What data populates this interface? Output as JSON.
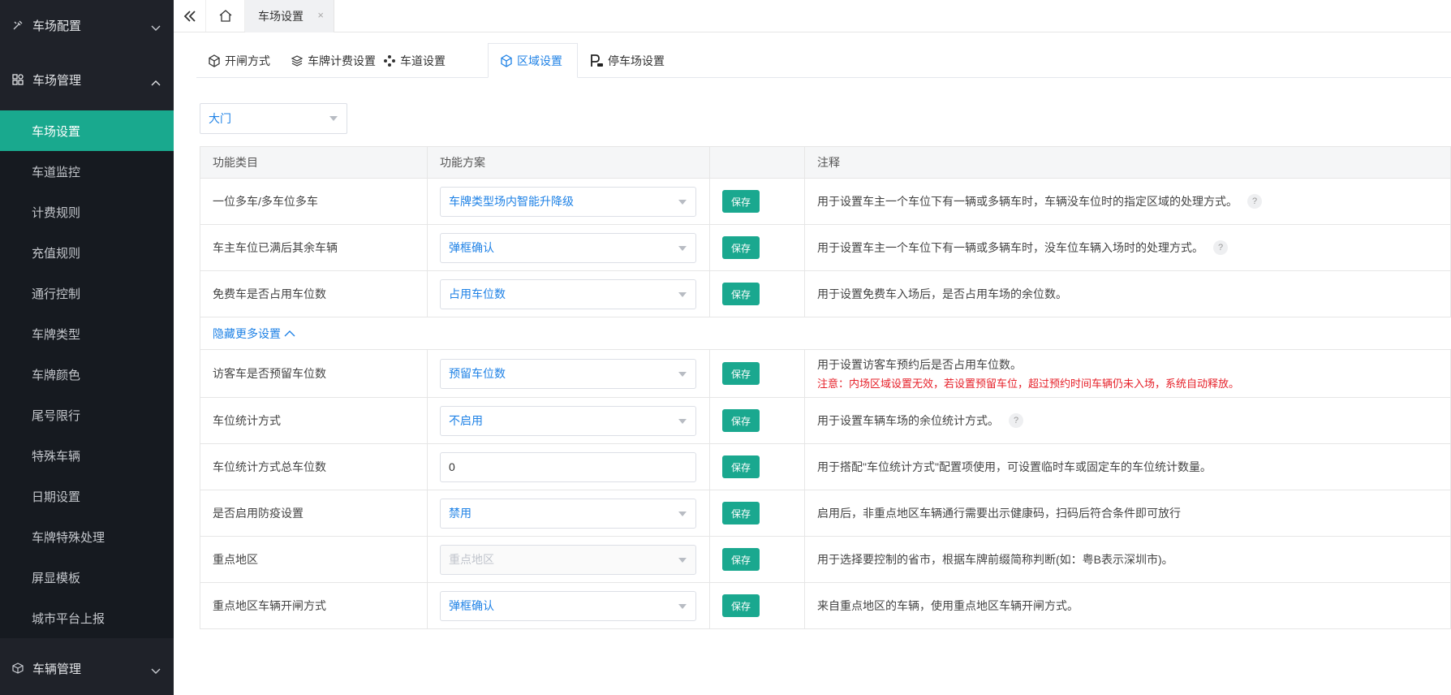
{
  "sidebar": {
    "groups": [
      {
        "label": "车场配置",
        "icon": "tools-icon"
      },
      {
        "label": "车场管理",
        "icon": "manage-icon"
      },
      {
        "label": "车辆管理",
        "icon": "cube-icon"
      }
    ],
    "items": [
      "车场设置",
      "车道监控",
      "计费规则",
      "充值规则",
      "通行控制",
      "车牌类型",
      "车牌颜色",
      "尾号限行",
      "特殊车辆",
      "日期设置",
      "车牌特殊处理",
      "屏显模板",
      "城市平台上报"
    ],
    "active_index": 0
  },
  "topbar": {
    "page_tab": "车场设置",
    "close": "×"
  },
  "tabs": [
    {
      "label": "开闸方式",
      "icon": "cube-outline-icon"
    },
    {
      "label": "车牌计费设置",
      "icon": "layers-icon"
    },
    {
      "label": "车道设置",
      "icon": "lane-icon"
    },
    {
      "label": "区域设置",
      "icon": "cube-outline-icon"
    },
    {
      "label": "停车场设置",
      "icon": "parking-icon"
    }
  ],
  "active_tab_index": 3,
  "area_select": "大门",
  "table": {
    "headers": [
      "功能类目",
      "功能方案",
      "",
      "注释"
    ],
    "save_label": "保存",
    "toggle_label": "隐藏更多设置",
    "rows": [
      {
        "category": "一位多车/多车位多车",
        "value": "车牌类型场内智能升降级",
        "note": "用于设置车主一个车位下有一辆或多辆车时，车辆没车位时的指定区域的处理方式。",
        "help": "?"
      },
      {
        "category": "车主车位已满后其余车辆",
        "value": "弹框确认",
        "note": "用于设置车主一个车位下有一辆或多辆车时，没车位车辆入场时的处理方式。",
        "help": "?"
      },
      {
        "category": "免费车是否占用车位数",
        "value": "占用车位数",
        "note": "用于设置免费车入场后，是否占用车场的余位数。"
      },
      {
        "category": "访客车是否预留车位数",
        "value": "预留车位数",
        "note": "用于设置访客车预约后是否占用车位数。",
        "warning": "注意：内场区域设置无效，若设置预留车位，超过预约时间车辆仍未入场，系统自动释放。"
      },
      {
        "category": "车位统计方式",
        "value": "不启用",
        "note": "用于设置车辆车场的余位统计方式。",
        "help": "?"
      },
      {
        "category": "车位统计方式总车位数",
        "input_value": "0",
        "note": "用于搭配\"车位统计方式\"配置项使用，可设置临时车或固定车的车位统计数量。"
      },
      {
        "category": "是否启用防疫设置",
        "value": "禁用",
        "note": "启用后，非重点地区车辆通行需要出示健康码，扫码后符合条件即可放行"
      },
      {
        "category": "重点地区",
        "placeholder": "重点地区",
        "note": "用于选择要控制的省市，根据车牌前缀简称判断(如：粤B表示深圳市)。"
      },
      {
        "category": "重点地区车辆开闸方式",
        "value": "弹框确认",
        "note": "来自重点地区的车辆，使用重点地区车辆开闸方式。"
      }
    ]
  },
  "colors": {
    "sidebar_bg": "#1f2229",
    "active_green": "#19a98e",
    "link_blue": "#1f82e6",
    "warning_red": "#e6212a"
  }
}
